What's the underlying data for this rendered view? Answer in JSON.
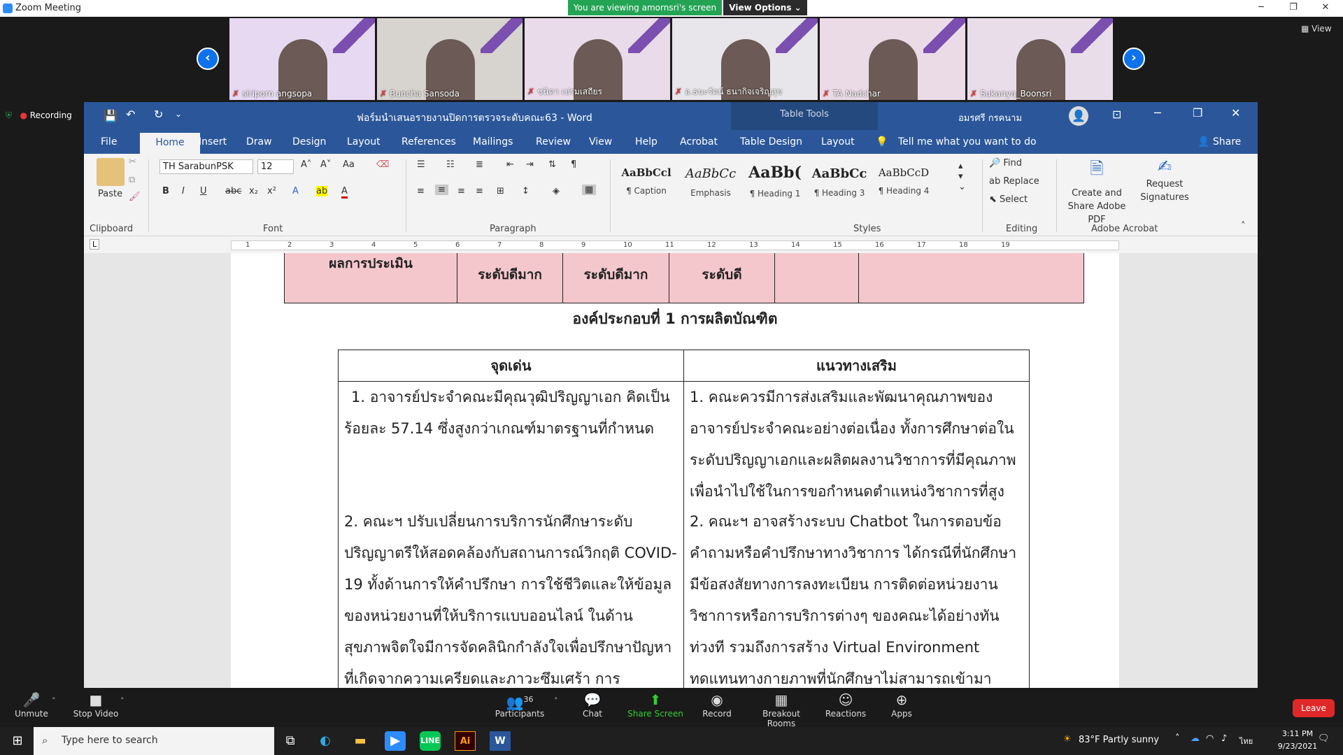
{
  "zoom": {
    "window_title": "Zoom Meeting",
    "viewing_banner": "You are viewing amornsri's screen",
    "view_options": "View Options ⌄",
    "view_label": "View",
    "recording": "Recording",
    "participants": [
      {
        "name": "siriporn angsopa",
        "color": "#e7d9f2"
      },
      {
        "name": "Buncha Sansoda",
        "color": "#d7d3cf"
      },
      {
        "name": "ชนิดา เปรมเสถียร",
        "color": "#e9dbe9"
      },
      {
        "name": "อ.ธนะรัตน์ ธนากิจเจริญสุข",
        "color": "#e8e6ea"
      },
      {
        "name": "TA Nadchar",
        "color": "#ebdbe6"
      },
      {
        "name": "Sukanya_Boonsri",
        "color": "#e9dde9"
      }
    ],
    "toolbar": {
      "unmute": "Unmute",
      "stop_video": "Stop Video",
      "participants": "Participants",
      "participant_count": "36",
      "chat": "Chat",
      "share_screen": "Share Screen",
      "record": "Record",
      "breakout": "Breakout Rooms",
      "reactions": "Reactions",
      "apps": "Apps",
      "leave": "Leave"
    }
  },
  "word": {
    "doc_title": "ฟอร์มนำเสนอรายงานปิดการตรวจระดับคณะ63  -  Word",
    "table_tools": "Table Tools",
    "user": "อมรศรี กรคนาม",
    "tabs": [
      "File",
      "Home",
      "Insert",
      "Draw",
      "Design",
      "Layout",
      "References",
      "Mailings",
      "Review",
      "View",
      "Help",
      "Acrobat",
      "Table Design",
      "Layout"
    ],
    "tell_me": "Tell me what you want to do",
    "share": "Share",
    "font_name": "TH SarabunPSK",
    "font_size": "12",
    "paste": "Paste",
    "groups": {
      "clipboard": "Clipboard",
      "font": "Font",
      "paragraph": "Paragraph",
      "styles": "Styles",
      "editing": "Editing",
      "acrobat": "Adobe Acrobat"
    },
    "styles": [
      {
        "preview": "AaBbCcl",
        "name": "¶ Caption"
      },
      {
        "preview": "AaBbCc",
        "name": "Emphasis"
      },
      {
        "preview": "AaBb(",
        "name": "¶ Heading 1"
      },
      {
        "preview": "AaBbCc",
        "name": "¶ Heading 3"
      },
      {
        "preview": "AaBbCcD",
        "name": "¶ Heading 4"
      }
    ],
    "editing": {
      "find": "Find",
      "replace": "Replace",
      "select": "Select"
    },
    "acrobat": {
      "create": "Create and Share Adobe PDF",
      "request": "Request Signatures"
    },
    "ruler": [
      "1",
      "2",
      "3",
      "4",
      "5",
      "6",
      "7",
      "8",
      "9",
      "10",
      "11",
      "12",
      "13",
      "14",
      "15",
      "16",
      "17",
      "18",
      "19"
    ]
  },
  "document": {
    "eval_header": "ผลการประเมิน",
    "eval_levels": [
      "ระดับดีมาก",
      "ระดับดีมาก",
      "ระดับดี"
    ],
    "section_title": "องค์ประกอบที่ 1 การผลิตบัณฑิต",
    "col_strength": "จุดเด่น",
    "col_improve": "แนวทางเสริม",
    "strength_1": "1. อาจารย์ประจำคณะมีคุณวุฒิปริญญาเอก คิดเป็นร้อยละ 57.14 ซึ่งสูงกว่าเกณฑ์มาตรฐานที่กำหนด",
    "strength_2": "2. คณะฯ ปรับเปลี่ยนการบริการนักศึกษาระดับปริญญาตรีให้สอดคล้องกับสถานการณ์วิกฤติ COVID-19 ทั้งด้านการให้คำปรึกษา การใช้ชีวิตและให้ข้อมูลของหน่วยงานที่ให้บริการแบบออนไลน์ ในด้านสุขภาพจิตใจมีการจัดคลินิกกำลังใจเพื่อปรึกษาปัญหาที่เกิดจากความเครียดและภาวะซึมเศร้า การ",
    "improve_1": "1. คณะควรมีการส่งเสริมและพัฒนาคุณภาพของอาจารย์ประจำคณะอย่างต่อเนื่อง ทั้งการศึกษาต่อในระดับปริญญาเอกและผลิตผลงานวิชาการที่มีคุณภาพเพื่อนำไปใช้ในการขอกำหนดตำแหน่งวิชาการที่สูงขึ้น",
    "improve_2": "2. คณะฯ อาจสร้างระบบ Chatbot ในการตอบข้อคำถามหรือคำปรึกษาทางวิชาการ ได้กรณีที่นักศึกษามีข้อสงสัยทางการลงทะเบียน การติดต่อหน่วยงานวิชาการหรือการบริการต่างๆ ของคณะได้อย่างทันท่วงที รวมถึงการสร้าง Virtual Environment ทดแทนทางกายภาพที่นักศึกษาไม่สามารถเข้ามา"
  },
  "taskbar": {
    "search": "Type here to search",
    "weather": "83°F  Partly sunny",
    "lang": "ไทย",
    "time": "3:11 PM",
    "date": "9/23/2021"
  }
}
